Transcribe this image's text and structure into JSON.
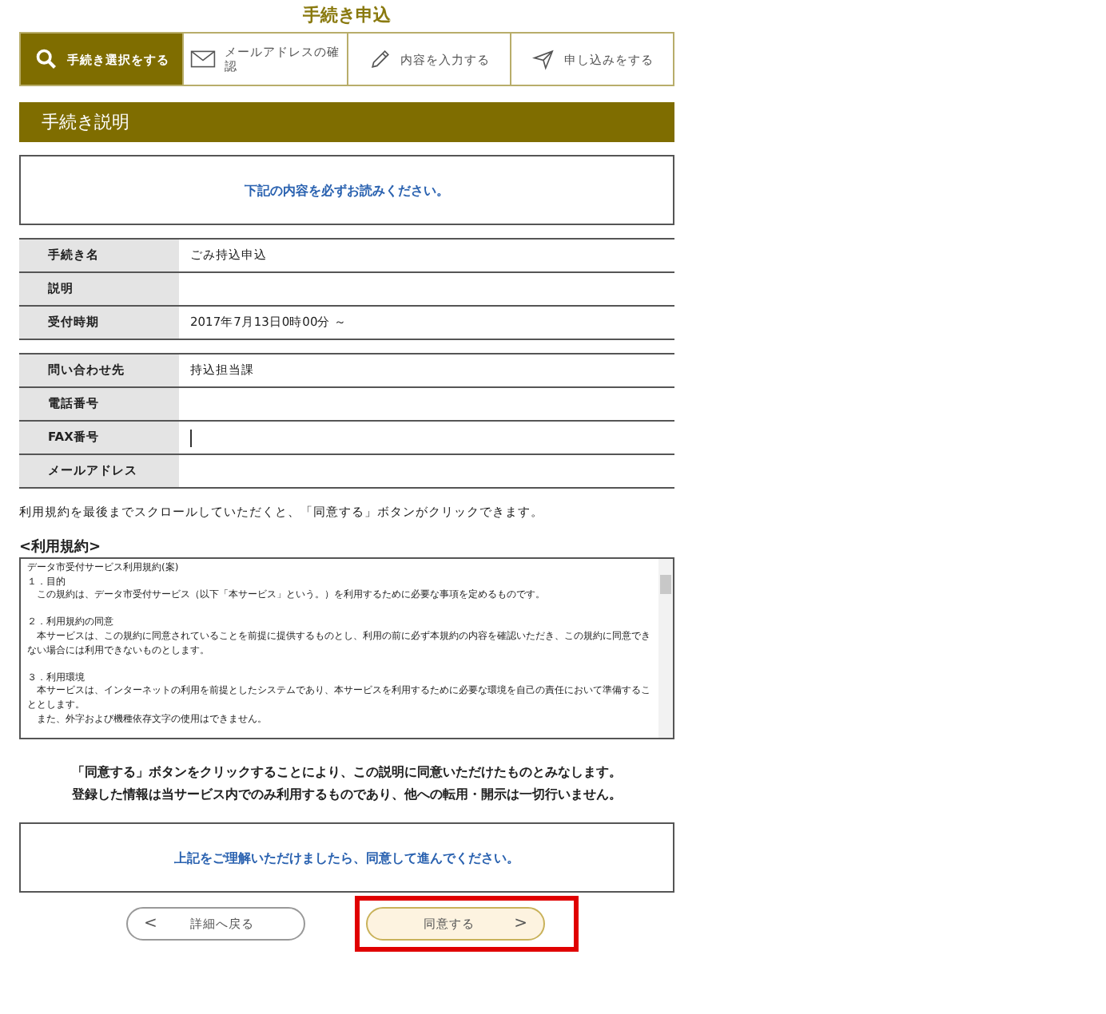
{
  "page_title": "手続き申込",
  "steps": [
    {
      "label": "手続き選択をする",
      "kind": "search",
      "selected": true
    },
    {
      "label": "メールアドレスの確認",
      "kind": "mail",
      "selected": false
    },
    {
      "label": "内容を入力する",
      "kind": "pencil",
      "selected": false
    },
    {
      "label": "申し込みをする",
      "kind": "send",
      "selected": false
    }
  ],
  "section_title": "手続き説明",
  "notice": "下記の内容を必ずお読みください。",
  "info_tables": [
    [
      {
        "label": "手続き名",
        "value": "ごみ持込申込"
      },
      {
        "label": "説明"
      },
      {
        "label": "受付時期",
        "value": "2017年7月13日0時00分 ～"
      }
    ],
    [
      {
        "label": "問い合わせ先",
        "value": "持込担当課"
      },
      {
        "label": "電話番号"
      },
      {
        "label": "FAX番号",
        "cursor": true
      },
      {
        "label": "メールアドレス"
      }
    ]
  ],
  "scroll_note": "利用規約を最後までスクロールしていただくと、「同意する」ボタンがクリックできます。",
  "terms_heading": "<利用規約>",
  "terms_blocks": [
    [
      "データ市受付サービス利用規約(案)",
      "１．目的",
      "　この規約は、データ市受付サービス（以下「本サービス」という。）を利用するために必要な事項を定めるものです。"
    ],
    [
      "２．利用規約の同意",
      "　本サービスは、この規約に同意されていることを前提に提供するものとし、利用の前に必ず本規約の内容を確認いただき、この規約に同意できない場合には利用できないものとします。"
    ],
    [
      "３．利用環境",
      "　本サービスは、インターネットの利用を前提としたシステムであり、本サービスを利用するために必要な環境を自己の責任において準備することとします。",
      "　また、外字および機種依存文字の使用はできません。"
    ]
  ],
  "agreement_lines": [
    "「同意する」ボタンをクリックすることにより、この説明に同意いただけたものとみなします。",
    "登録した情報は当サービス内でのみ利用するものであり、他への転用・開示は一切行いません。"
  ],
  "confirm_notice": "上記をご理解いただけましたら、同意して進んでください。",
  "buttons": [
    {
      "label": "詳細へ戻る",
      "arrow": "<",
      "kind": "back",
      "highlighted": false
    },
    {
      "label": "同意する",
      "arrow": ">",
      "kind": "next",
      "highlighted": true
    }
  ]
}
